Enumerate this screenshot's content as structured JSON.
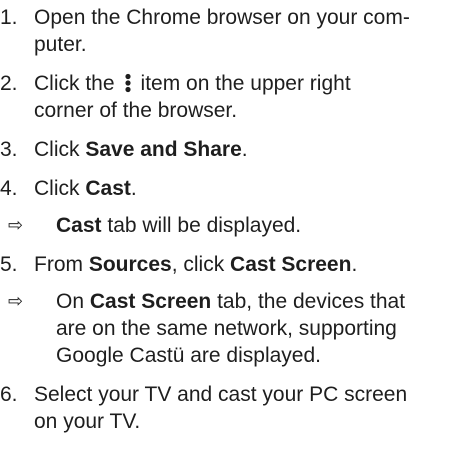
{
  "steps": [
    {
      "num": "1.",
      "t1": "Open the Chrome browser on your com-",
      "t2": "puter."
    },
    {
      "num": "2.",
      "pre": "Click the",
      "icon": "more-vert-icon",
      "mid": "item on the upper right",
      "t2": "corner of the browser."
    },
    {
      "num": "3.",
      "pre": "Click ",
      "bold": "Save and Share",
      "post": "."
    },
    {
      "num": "4.",
      "pre": "Click ",
      "bold": "Cast",
      "post": "."
    },
    {
      "num": "5.",
      "pre": "From ",
      "bold1": "Sources",
      "mid": ", click ",
      "bold2": "Cast Screen",
      "post": "."
    },
    {
      "num": "6.",
      "t1": "Select your TV and cast your PC screen",
      "t2": "on your TV."
    }
  ],
  "results": [
    {
      "arrow": "⇨",
      "bold": "Cast",
      "post": " tab will be displayed."
    },
    {
      "arrow": "⇨",
      "pre": "On ",
      "bold": "Cast Screen",
      "t1": " tab, the devices that",
      "t2": "are on the same network, supporting",
      "t3": "Google Castü are displayed."
    }
  ]
}
